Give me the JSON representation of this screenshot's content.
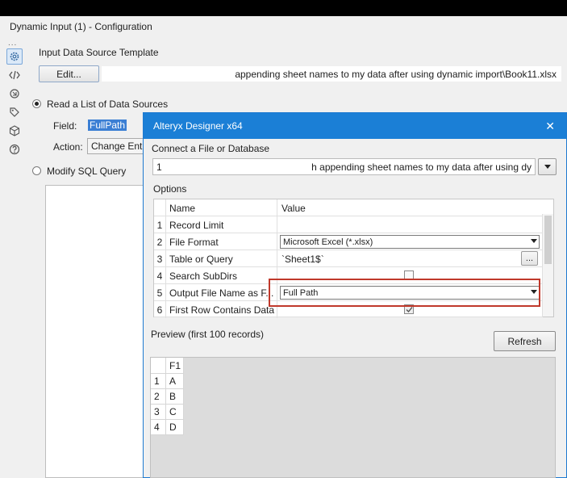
{
  "window": {
    "panel_title": "Dynamic Input (1) - Configuration"
  },
  "rail": {
    "dots": "...",
    "icons": [
      "gear-icon",
      "code-icon",
      "connection-icon",
      "tag-icon",
      "cube-icon",
      "help-icon"
    ]
  },
  "config": {
    "template_label": "Input Data Source Template",
    "edit_button": "Edit...",
    "template_path": "appending sheet names to my data after using dynamic import\\Book11.xlsx",
    "read_list_label": "Read a List of Data Sources",
    "field_label": "Field:",
    "field_value": "FullPath",
    "action_label": "Action:",
    "action_value": "Change Entir",
    "modify_sql_label": "Modify SQL Query"
  },
  "dialog": {
    "title": "Alteryx Designer x64",
    "close": "✕",
    "connect_label": "Connect a File or Database",
    "connect_value_start": "1",
    "connect_value_end": "h appending sheet names to my data after using dy",
    "options_label": "Options",
    "col_name": "Name",
    "col_value": "Value",
    "options": [
      {
        "num": "1",
        "name": "Record Limit",
        "value": ""
      },
      {
        "num": "2",
        "name": "File Format",
        "value": "Microsoft Excel (*.xlsx)"
      },
      {
        "num": "3",
        "name": "Table or Query",
        "value": "`Sheet1$`",
        "button": "..."
      },
      {
        "num": "4",
        "name": "Search SubDirs",
        "value": ""
      },
      {
        "num": "5",
        "name": "Output File Name as F...",
        "value": "Full Path"
      },
      {
        "num": "6",
        "name": "First Row Contains Data",
        "value": ""
      }
    ],
    "preview_label": "Preview (first 100 records)",
    "refresh_button": "Refresh",
    "preview_header": "F1",
    "preview_rows": [
      {
        "num": "1",
        "value": "A"
      },
      {
        "num": "2",
        "value": "B"
      },
      {
        "num": "3",
        "value": "C"
      },
      {
        "num": "4",
        "value": "D"
      }
    ]
  },
  "colors": {
    "dialog_title_bg": "#1b7fd6",
    "highlight_border": "#c0392b"
  }
}
